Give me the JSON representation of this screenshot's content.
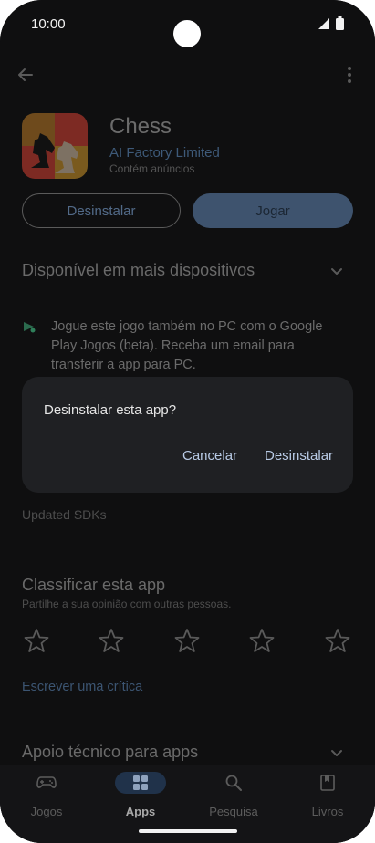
{
  "status": {
    "time": "10:00"
  },
  "app": {
    "title": "Chess",
    "developer": "AI Factory Limited",
    "ads": "Contém anúncios",
    "uninstall_label": "Desinstalar",
    "play_label": "Jogar"
  },
  "devices_section": {
    "title": "Disponível em mais dispositivos",
    "text": "Jogue este jogo também no PC com o Google Play Jogos (beta). Receba um email para transferir a app para PC."
  },
  "dialog": {
    "title": "Desinstalar esta app?",
    "cancel_label": "Cancelar",
    "confirm_label": "Desinstalar"
  },
  "updated_text": "Updated SDKs",
  "rating": {
    "title": "Classificar esta app",
    "subtitle": "Partilhe a sua opinião com outras pessoas.",
    "star_count": 5,
    "write_review": "Escrever uma crítica"
  },
  "support_section": {
    "title": "Apoio técnico para apps"
  },
  "nav": {
    "items": [
      {
        "label": "Jogos",
        "icon": "gamepad-icon",
        "active": false
      },
      {
        "label": "Apps",
        "icon": "apps-grid-icon",
        "active": true
      },
      {
        "label": "Pesquisa",
        "icon": "search-icon",
        "active": false
      },
      {
        "label": "Livros",
        "icon": "book-icon",
        "active": false
      }
    ]
  },
  "colors": {
    "accent": "#3e536e",
    "dialog_bg": "#1f2023",
    "dialog_button": "#b9cbe6",
    "link": "#3c5572"
  }
}
